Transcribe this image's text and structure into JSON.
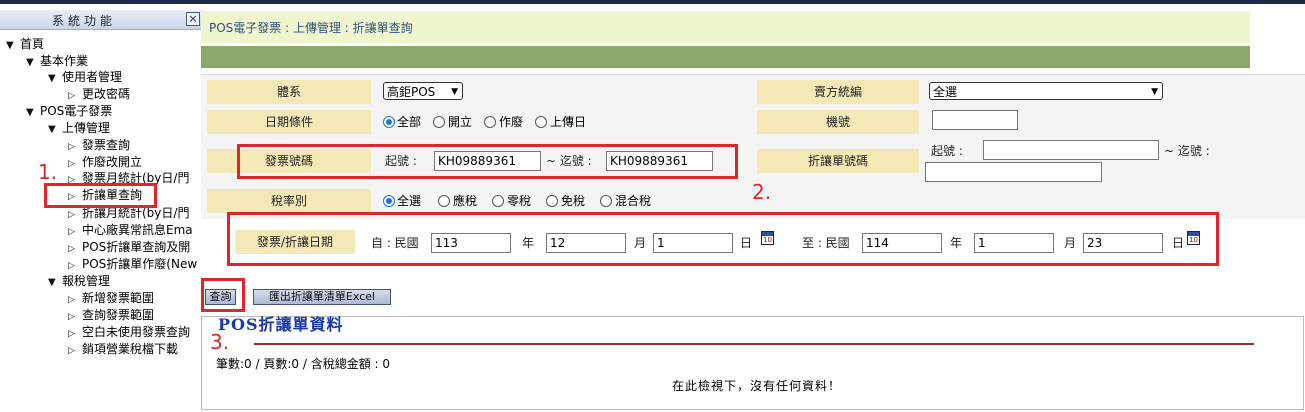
{
  "sidebar": {
    "title": "系統功能",
    "close_label": "×",
    "items": [
      {
        "label": "首頁"
      },
      {
        "label": "基本作業"
      },
      {
        "label": "使用者管理"
      },
      {
        "label": "更改密碼"
      },
      {
        "label": "POS電子發票"
      },
      {
        "label": "上傳管理"
      },
      {
        "label": "發票查詢"
      },
      {
        "label": "作廢改開立"
      },
      {
        "label": "發票月統計(by日/門"
      },
      {
        "label": "折讓單查詢"
      },
      {
        "label": "折讓月統計(by日/門"
      },
      {
        "label": "中心廠異常訊息Ema"
      },
      {
        "label": "POS折讓單查詢及開"
      },
      {
        "label": "POS折讓單作廢(New"
      },
      {
        "label": "報稅管理"
      },
      {
        "label": "新增發票範圍"
      },
      {
        "label": "查詢發票範圍"
      },
      {
        "label": "空白未使用發票查詢"
      },
      {
        "label": "銷項營業稅檔下載"
      }
    ]
  },
  "annotations": {
    "step1": "1.",
    "step2": "2.",
    "step3": "3."
  },
  "header": {
    "breadcrumb": "POS電子發票 : 上傳管理 : 折讓單查詢"
  },
  "form": {
    "system_label": "體系",
    "system_value": "高鉅POS",
    "seller_label": "賣方統編",
    "seller_value": "全選",
    "date_cond_label": "日期條件",
    "date_cond_options": [
      "全部",
      "開立",
      "作廢",
      "上傳日"
    ],
    "date_cond_selected": "全部",
    "machine_label": "機號",
    "machine_value": "",
    "invoice_no_label": "發票號碼",
    "invoice_start_label": "起號 :",
    "invoice_start_value": "KH09889361",
    "invoice_end_label": "~ 迄號 :",
    "invoice_end_value": "KH09889361",
    "allowance_no_label": "折讓單號碼",
    "allowance_start_label": "起號 :",
    "allowance_start_value": "",
    "allowance_end_label": "~ 迄號 :",
    "allowance_end_value": "",
    "tax_label": "稅率別",
    "tax_options": [
      "全選",
      "應稅",
      "零稅",
      "免稅",
      "混合稅"
    ],
    "tax_selected": "全選",
    "date_range_label": "發票/折讓日期",
    "from_label": "自 : 民國",
    "from_year": "113",
    "from_month": "12",
    "from_day": "1",
    "to_label": "至 : 民國",
    "to_year": "114",
    "to_month": "1",
    "to_day": "23",
    "year_unit": "年",
    "month_unit": "月",
    "day_unit": "日"
  },
  "toolbar": {
    "query_label": "查詢",
    "export_label": "匯出折讓單清單Excel"
  },
  "result": {
    "title": "POS折讓單資料",
    "stats": "筆數:0 / 頁數:0 / 含稅總金額 : 0",
    "empty_message": "在此檢視下，沒有任何資料！"
  },
  "colors": {
    "label_bg": "#f3e8b6",
    "header_bg": "#eef5cf",
    "green_bar": "#8aa86a",
    "highlight": "#e0262b",
    "title_blue": "#1b38a8"
  }
}
